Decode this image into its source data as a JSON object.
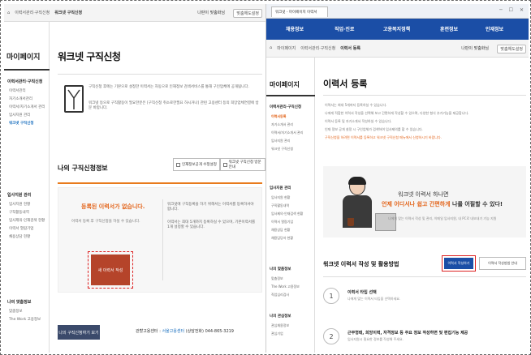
{
  "left": {
    "breadcrumb": [
      "홈",
      "이력서관리·구직신청",
      "워크넷 구직신청"
    ],
    "user": "나판이 맞춤화님",
    "logout_label": "맞춤해도설정",
    "sidebar": {
      "title": "마이페이지",
      "sections": [
        {
          "label": "이력서관리·구직신청",
          "items": [
            "이력서관리",
            "자기소개서관리",
            "이력서/자기소개서 관리",
            "입사지원 관리",
            "워크넷 구직신청"
          ],
          "active": 4
        },
        {
          "label": "입사지원 관리",
          "items": [
            "입사지원 현황",
            "구직활동내역",
            "입사제의·인재검색 현황",
            "이력서 열람기업",
            "채용상담 현황"
          ]
        },
        {
          "label": "나의 맞춤정보",
          "items": [
            "맞춤정보",
            "The Work 고용정보"
          ]
        }
      ]
    },
    "page_title": "워크넷 구직신청",
    "info_bullets": [
      "구직신청 후에는 기본으로 설정한 이력서는 자동으로 인재정보 검색서비스를 통해 구인업체에 공개됩니다.",
      "워크넷 등으로 구직활동이 필요한분은 [구직신청 취소로한필요 하시거나] 관련 고용센터 등의 희망업체연결에 방문 바랍니다."
    ],
    "section_title": "나의 구직신청정보",
    "btn_print": "인재정보공개 수정설정",
    "btn_cancel": "워크넷 구직신청 방문안내",
    "empty_msg": "등록된 이력서가 없습니다.",
    "empty_note": "이력서 등록 후 구직신청을 하실 수 있습니다.",
    "right_bullets": [
      "워크넷에 구직등록을 하기 위해서는 이력서를 등록하셔야 합니다.",
      "이력서는 최대 5개까지 등록하실 수 있으며, 기본이력서를 1개 설정할 수 있습니다."
    ],
    "write_label": "새 이력서 작성",
    "footer_prefix": "관할고용센터 :",
    "footer_center": "서울고용센터",
    "footer_phone": "(상담전화) 044-865-3219",
    "dark_btn": "나의 구직신청하기 보기"
  },
  "right": {
    "browser_tab": "워크넷 - 마이페이지 이력서",
    "nav": [
      "채용정보",
      "직업·진로",
      "고용복지정책",
      "훈련정보",
      "인재정보"
    ],
    "breadcrumb": [
      "홈",
      "마이페이지",
      "이력서관리·구직신청",
      "이력서 등록"
    ],
    "user": "나판이 맞춤화님",
    "logout_label": "맞춤해도설정",
    "sidebar": {
      "title": "마이페이지",
      "sections": [
        {
          "label": "이력서관리·구직신청",
          "items": [
            "이력서등록",
            "자기소개서 관리",
            "이력서/자기소개서 관리",
            "입사지원 관리",
            "워크넷 구직신청"
          ],
          "active": 0
        },
        {
          "label": "입사지원 관리",
          "items": [
            "입사지원 현황",
            "구직활동내역",
            "입사제의·인재검색 현황",
            "이력서 열람기업",
            "채용상담 현황",
            "채용담당자 현황"
          ]
        },
        {
          "label": "나의 맞춤정보",
          "items": [
            "맞춤정보",
            "The Work 고용정보",
            "직업심리검사"
          ]
        },
        {
          "label": "나의 관심정보",
          "items": [
            "관심채용정보",
            "관심기업"
          ]
        }
      ]
    },
    "page_title": "이력서 등록",
    "notes": [
      "이력서는 최대 5개까지 등록하실 수 있습니다.",
      "나에게 적합한 이력서 작성을 선택해 보고 간편하게 작성할 수 있으며, 다양한 형식 추가기능을 제공합니다.",
      "이력서 등록 및 자기소개서 작성하실 수 있습니다.",
      "인재 정보 공개 설정 시 구인업체가 검색하여 입사제의를 할 수 있습니다.",
      "구직신청을 하려면 이력서를 등록하고 워크넷 구직신청 메뉴에서 신청하시기 바랍니다."
    ],
    "promo_line1": "워크넷 이력서 하나면",
    "promo_line2_a": "언제 어디서나 쉽고 간편하게",
    "promo_line2_b": " 나를 어필할 수 있다!",
    "promo_note": "나에게 맞는 이력서 작성 및 관리, 이메일 입사지원, 내 PC로 내보내기 기능 지원",
    "section_title": "워크넷 이력서 작성 및 활용방법",
    "btn_write": "이력서 작성하기",
    "btn_guide": "이력서 작성방법 안내",
    "steps": [
      {
        "num": "1",
        "title": "이력서 타입 선택",
        "desc": "나에게 맞는 이력서 타입을 선택하세요."
      },
      {
        "num": "2",
        "title": "근무형태, 희망이력, 자격정보 등 주요 정보 작성하면 및 편집기능 제공",
        "desc": "입사지원시 필요한 정보를 작성해 주세요."
      }
    ]
  },
  "colors": {
    "nav_blue": "#1b4ea6",
    "accent_orange": "#e3661d",
    "write_red": "#b5442a",
    "dark_btn": "#3b4a6b"
  }
}
